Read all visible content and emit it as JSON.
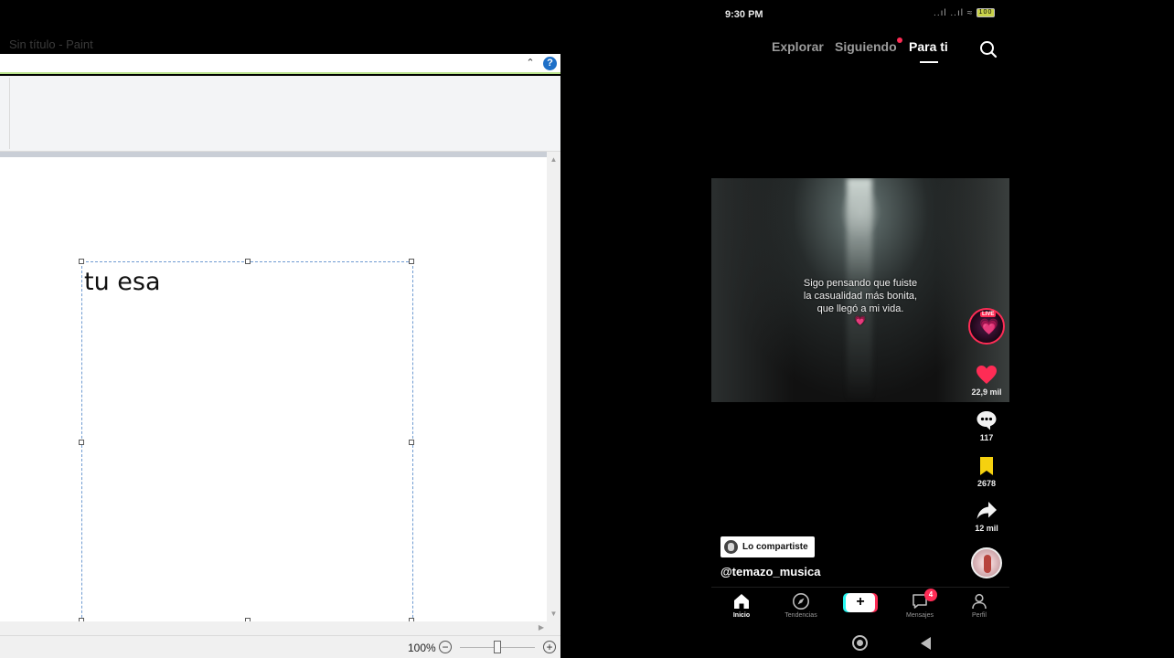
{
  "paint": {
    "window_title": "Sin título - Paint",
    "collapse_glyph": "⌃",
    "help_glyph": "?",
    "canvas_text": "tu esa",
    "zoom": {
      "label": "100%",
      "minus_glyph": "−",
      "plus_glyph": "+"
    }
  },
  "phone": {
    "status": {
      "time": "9:30 PM",
      "signal": "..ıl ..ıl ≈",
      "battery": "100"
    },
    "top_tabs": [
      {
        "label": "Explorar",
        "active": false
      },
      {
        "label": "Siguiendo",
        "active": false,
        "has_dot": true
      },
      {
        "label": "Para ti",
        "active": true
      }
    ],
    "video": {
      "caption_lines": [
        "Sigo pensando que fuiste",
        "la casualidad más bonita,",
        "que llegó a mi vida."
      ],
      "caption_emoji": "💗"
    },
    "live": {
      "badge": "LIVE",
      "glyph": "💗"
    },
    "actions": {
      "likes": "22,9 mil",
      "comments": "117",
      "saves": "2678",
      "shares": "12 mil"
    },
    "shared_pill": "Lo compartiste",
    "username": "@temazo_musica",
    "bottom_nav": {
      "inicio": "Inicio",
      "tendencias": "Tendencias",
      "create_glyph": "+",
      "mensajes": "Mensajes",
      "mensajes_badge": "4",
      "perfil": "Perfil"
    },
    "colors": {
      "accent_red": "#fe2c55",
      "accent_cyan": "#25f4ee",
      "save_yellow": "#f5d10f",
      "like_pink": "#fe2c55"
    },
    "icons": [
      "search-icon",
      "heart-icon",
      "comment-icon",
      "bookmark-icon",
      "share-icon",
      "home-icon",
      "compass-icon",
      "message-icon",
      "person-icon"
    ]
  }
}
